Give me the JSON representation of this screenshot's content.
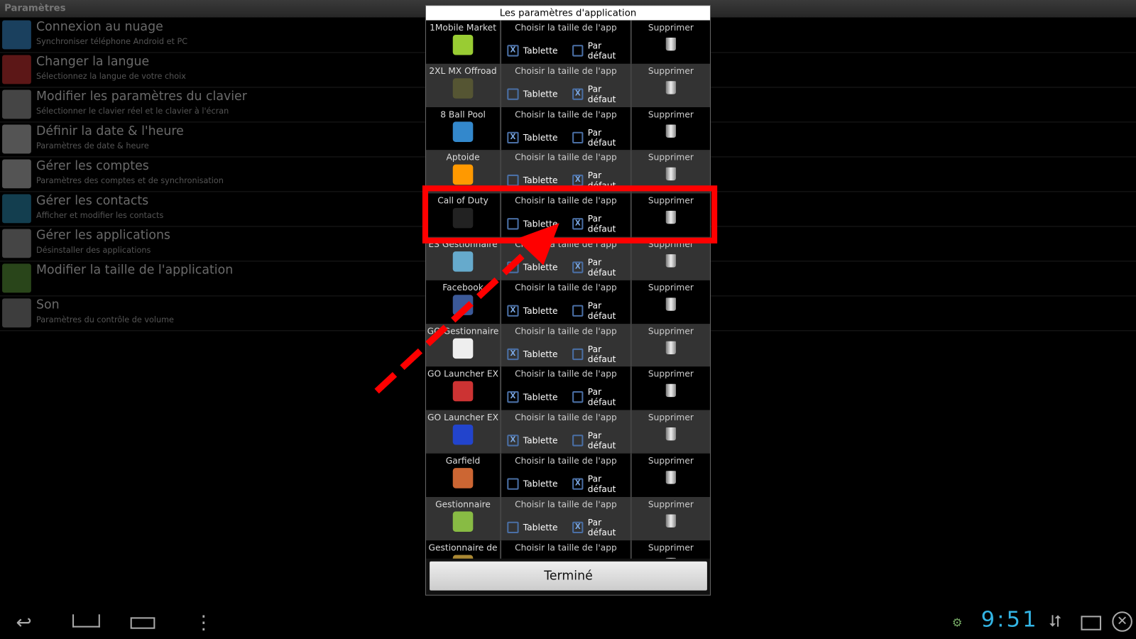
{
  "header": {
    "title": "Paramètres"
  },
  "settings": [
    {
      "title": "Connexion au nuage",
      "subtitle": "Synchroniser téléphone Android et PC",
      "icon": "cloud-icon",
      "color": "#3a8fd0"
    },
    {
      "title": "Changer la langue",
      "subtitle": "Sélectionnez la langue de votre choix",
      "icon": "flags-icon",
      "color": "#c33"
    },
    {
      "title": "Modifier les paramètres du clavier",
      "subtitle": "Sélectionner le clavier réel et le clavier à l'écran",
      "icon": "keyboard-icon",
      "color": "#999"
    },
    {
      "title": "Définir la date & l'heure",
      "subtitle": "Paramètres de date & heure",
      "icon": "calendar-icon",
      "color": "#bbb"
    },
    {
      "title": "Gérer les comptes",
      "subtitle": "Paramètres des comptes et de synchronisation",
      "icon": "user-icon",
      "color": "#bbb"
    },
    {
      "title": "Gérer les contacts",
      "subtitle": "Afficher et modifier les contacts",
      "icon": "contacts-icon",
      "color": "#2a8ab0"
    },
    {
      "title": "Gérer les applications",
      "subtitle": "Désinstaller des applications",
      "icon": "trash-apps-icon",
      "color": "#999"
    },
    {
      "title": "Modifier la taille de l'application",
      "subtitle": "",
      "icon": "resize-icon",
      "color": "#5a9a3a"
    },
    {
      "title": "Son",
      "subtitle": "Paramètres du contrôle de volume",
      "icon": "speaker-icon",
      "color": "#888"
    }
  ],
  "dialog": {
    "title": "Les paramètres d'application",
    "size_label": "Choisir la taille de l'app",
    "tablet_label": "Tablette",
    "default_label": "Par défaut",
    "delete_label": "Supprimer",
    "done_label": "Terminé",
    "checked_mark": "X",
    "apps": [
      {
        "name": "1Mobile Market",
        "tablet": true,
        "color": "#9c3"
      },
      {
        "name": "2XL MX Offroad",
        "tablet": false,
        "color": "#553"
      },
      {
        "name": "8 Ball Pool",
        "tablet": true,
        "color": "#38c"
      },
      {
        "name": "Aptoide",
        "tablet": false,
        "color": "#f90"
      },
      {
        "name": "Call of Duty",
        "tablet": false,
        "color": "#222"
      },
      {
        "name": "ES Gestionnaire",
        "tablet": false,
        "color": "#6ac"
      },
      {
        "name": "Facebook",
        "tablet": true,
        "color": "#3b5998"
      },
      {
        "name": "GO Gestionnaire",
        "tablet": true,
        "color": "#eee"
      },
      {
        "name": "GO Launcher EX",
        "tablet": true,
        "color": "#c33"
      },
      {
        "name": "GO Launcher EX",
        "tablet": true,
        "color": "#24c"
      },
      {
        "name": "Garfield",
        "tablet": false,
        "color": "#c63"
      },
      {
        "name": "Gestionnaire",
        "tablet": false,
        "color": "#8b4"
      },
      {
        "name": "Gestionnaire de",
        "tablet": false,
        "color": "#a83"
      }
    ]
  },
  "statusbar": {
    "time": "9:51"
  },
  "highlight_color": "#ff0000"
}
